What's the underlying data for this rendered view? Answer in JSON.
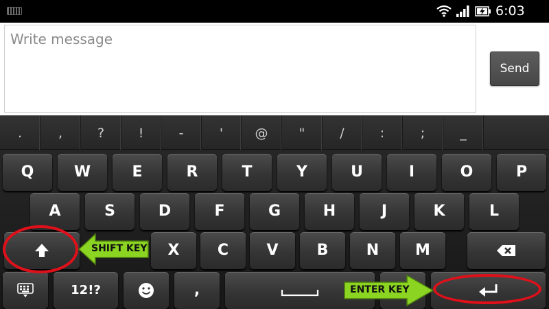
{
  "status_bar": {
    "time": "6:03 pm",
    "icons": [
      "keyboard-notification-icon",
      "wifi-icon",
      "signal-icon",
      "battery-charging-icon"
    ]
  },
  "compose": {
    "placeholder": "Write message",
    "value": "",
    "send_label": "Send"
  },
  "keyboard": {
    "symbols": [
      ".",
      ",",
      "?",
      "!",
      "-",
      "'",
      "@",
      "\"",
      "/",
      ":",
      ";",
      "_"
    ],
    "row1": [
      "Q",
      "W",
      "E",
      "R",
      "T",
      "Y",
      "U",
      "I",
      "O",
      "P"
    ],
    "row2": [
      "A",
      "S",
      "D",
      "F",
      "G",
      "H",
      "J",
      "K",
      "L"
    ],
    "row3": [
      "X",
      "C",
      "V",
      "B",
      "N",
      "M"
    ],
    "bottom": {
      "numbers_label": "12!?",
      "comma_label": ","
    },
    "special_keys": [
      "shift-icon",
      "backspace-icon",
      "keyboard-settings-icon",
      "emoji-icon",
      "space-bar-icon",
      "enter-icon"
    ]
  },
  "annotations": {
    "shift_label": "SHIFT KEY",
    "enter_label": "ENTER KEY",
    "ring_color": "#e0101a",
    "arrow_color": "#8bd422"
  }
}
